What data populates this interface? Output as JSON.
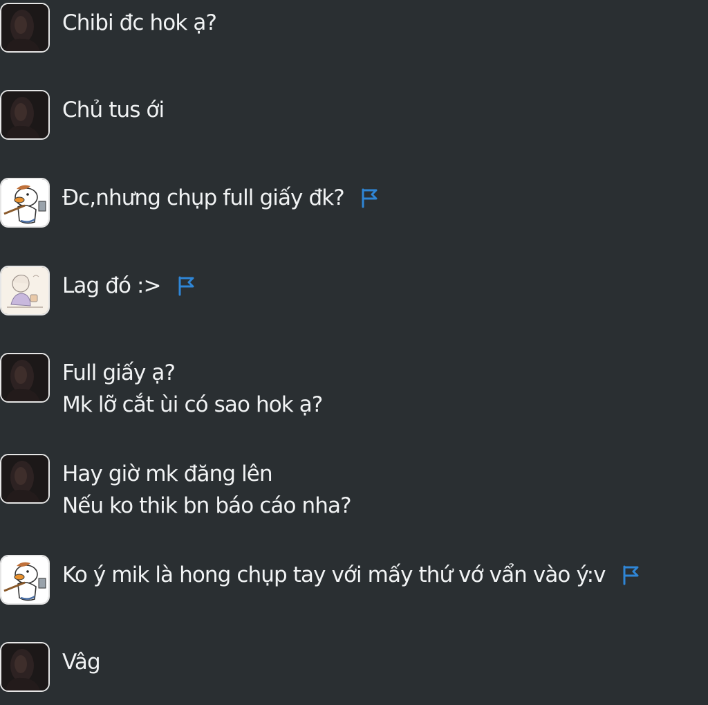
{
  "colors": {
    "background": "#2a2f32",
    "text": "#f1f3f4",
    "flag": "#2f86d6",
    "avatar_border": "#e6e6e6"
  },
  "icons": {
    "report": "flag-icon",
    "avatar_dark": "dark-portrait-avatar-icon",
    "avatar_duck": "cartoon-duck-avatar-icon",
    "avatar_sketch": "sketch-girl-avatar-icon"
  },
  "messages": [
    {
      "avatar": "dark",
      "lines": [
        "Chibi đc hok ạ?"
      ],
      "flag": false
    },
    {
      "avatar": "dark",
      "lines": [
        "Chủ tus ới"
      ],
      "flag": false
    },
    {
      "avatar": "duck",
      "lines": [
        "Đc,nhưng chụp full giấy đk?"
      ],
      "flag": true
    },
    {
      "avatar": "sketch",
      "lines": [
        "Lag đó :>"
      ],
      "flag": true
    },
    {
      "avatar": "dark",
      "lines": [
        "Full giấy ạ?",
        "Mk lỡ cắt ùi có sao hok ạ?"
      ],
      "flag": false
    },
    {
      "avatar": "dark",
      "lines": [
        "Hay giờ mk đăng lên",
        "Nếu ko thik bn báo cáo nha?"
      ],
      "flag": false
    },
    {
      "avatar": "duck",
      "lines": [
        "Ko ý mik là hong chụp tay với mấy thứ vớ vẩn vào ý:v"
      ],
      "flag": true
    },
    {
      "avatar": "dark",
      "lines": [
        "Vâg"
      ],
      "flag": false
    }
  ]
}
